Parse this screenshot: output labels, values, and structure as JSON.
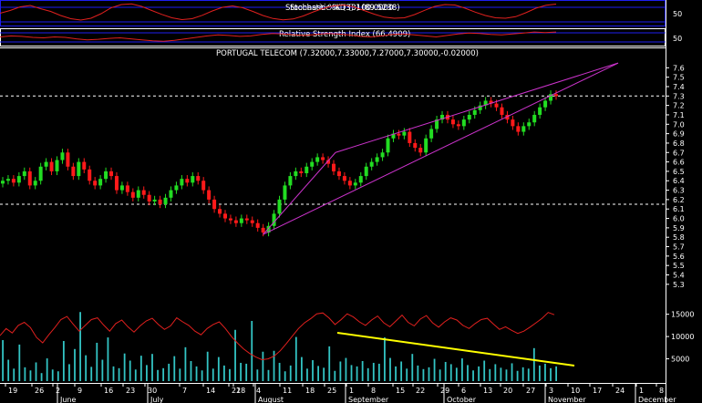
{
  "chart_data": [
    {
      "panel": "stochastic",
      "type": "line",
      "title": "Stochastic %D (3) (89.5238)",
      "overlapping_label": "Stochastic %K (3) 100.0000",
      "y_ticks": [
        "50"
      ],
      "values": [
        50,
        62,
        78,
        84,
        70,
        58,
        40,
        26,
        20,
        28,
        48,
        74,
        88,
        91,
        80,
        62,
        45,
        30,
        22,
        26,
        41,
        60,
        76,
        82,
        74,
        58,
        40,
        27,
        21,
        25,
        38,
        56,
        72,
        82,
        86,
        78,
        62,
        46,
        33,
        28,
        30,
        44,
        63,
        80,
        88,
        86,
        72,
        55,
        40,
        30,
        28,
        35,
        52,
        72,
        85,
        90
      ]
    },
    {
      "panel": "rsi",
      "type": "line",
      "title": "Relative Strength Index (66.4909)",
      "y_ticks": [
        "50"
      ],
      "values": [
        56,
        58,
        57,
        55,
        54,
        56,
        55,
        52,
        50,
        51,
        53,
        54,
        52,
        50,
        48,
        47,
        49,
        52,
        55,
        58,
        60,
        59,
        57,
        58,
        61,
        63,
        62,
        60,
        59,
        61,
        63,
        62,
        60,
        57,
        56,
        58,
        61,
        62,
        60,
        58,
        56,
        59,
        62,
        64,
        63,
        61,
        60,
        62,
        64,
        66,
        65,
        66
      ]
    },
    {
      "panel": "price",
      "type": "candlestick",
      "title": "PORTUGAL TELECOM (7.32000,7.33000,7.27000,7.30000,-0.02000)",
      "y_ticks": [
        "7.6",
        "7.5",
        "7.4",
        "7.3",
        "7.2",
        "7.1",
        "7.0",
        "6.9",
        "6.8",
        "6.7",
        "6.6",
        "6.5",
        "6.4",
        "6.3",
        "6.2",
        "6.1",
        "6.0",
        "5.9",
        "5.8",
        "5.7",
        "5.6",
        "5.5",
        "5.4",
        "5.3"
      ],
      "ylim": [
        5.25,
        7.7
      ],
      "h_lines": [
        7.3,
        6.15
      ],
      "closes": [
        6.4,
        6.42,
        6.38,
        6.45,
        6.5,
        6.35,
        6.4,
        6.55,
        6.6,
        6.5,
        6.62,
        6.7,
        6.55,
        6.45,
        6.6,
        6.52,
        6.4,
        6.35,
        6.42,
        6.5,
        6.45,
        6.3,
        6.35,
        6.28,
        6.22,
        6.3,
        6.25,
        6.18,
        6.2,
        6.15,
        6.22,
        6.3,
        6.35,
        6.42,
        6.38,
        6.45,
        6.4,
        6.3,
        6.2,
        6.1,
        6.05,
        6.0,
        5.98,
        5.95,
        6.0,
        5.98,
        5.95,
        5.9,
        5.85,
        5.92,
        6.05,
        6.2,
        6.35,
        6.45,
        6.5,
        6.48,
        6.55,
        6.6,
        6.65,
        6.62,
        6.58,
        6.5,
        6.45,
        6.4,
        6.35,
        6.38,
        6.45,
        6.55,
        6.6,
        6.65,
        6.7,
        6.85,
        6.9,
        6.88,
        6.92,
        6.8,
        6.75,
        6.7,
        6.85,
        6.95,
        7.05,
        7.1,
        7.05,
        7.0,
        6.98,
        7.05,
        7.1,
        7.15,
        7.2,
        7.25,
        7.22,
        7.18,
        7.1,
        7.05,
        6.98,
        6.92,
        6.98,
        7.02,
        7.1,
        7.18,
        7.25,
        7.32,
        7.3
      ],
      "trendlines": [
        {
          "from": [
            "Aug 4",
            5.83
          ],
          "to": [
            "Nov 17",
            7.65
          ]
        },
        {
          "from": [
            "Sep 25",
            6.7
          ],
          "to": [
            "Nov 17",
            7.65
          ]
        },
        {
          "from": [
            "Aug 4",
            5.83
          ],
          "to": [
            "Sep 25",
            6.7
          ]
        }
      ]
    },
    {
      "panel": "volume",
      "type": "bar",
      "y_ticks": [
        "15000",
        "10000",
        "5000"
      ],
      "ylim": [
        0,
        18000
      ],
      "values": [
        9200,
        4800,
        2800,
        8200,
        3100,
        2400,
        4200,
        1800,
        5100,
        2600,
        2200,
        9000,
        3800,
        7200,
        15500,
        5800,
        3200,
        8600,
        4800,
        9800,
        3300,
        2900,
        6200,
        4600,
        2600,
        5700,
        3600,
        6100,
        2500,
        2900,
        3900,
        5600,
        2800,
        7600,
        4500,
        3300,
        2400,
        6600,
        2800,
        5400,
        3500,
        2700,
        11500,
        4100,
        3900,
        13500,
        2600,
        6600,
        2500,
        6800,
        4100,
        2200,
        3500,
        9900,
        5400,
        2800,
        4700,
        3400,
        3000,
        7800,
        2300,
        4400,
        5200,
        3600,
        3300,
        4500,
        2900,
        4100,
        3900,
        9800,
        5200,
        3300,
        4400,
        2800,
        6100,
        3500,
        2700,
        3100,
        5000,
        2600,
        4300,
        3800,
        3000,
        5100,
        3600,
        2400,
        3300,
        4600,
        2700,
        3800,
        3000,
        2600,
        4000,
        2300,
        3100,
        2800,
        7400,
        3500,
        3900,
        2900,
        3300
      ],
      "overlay_line": [
        10200,
        11800,
        10800,
        12500,
        13200,
        12000,
        9800,
        8600,
        10400,
        12000,
        13800,
        14500,
        12800,
        11200,
        12500,
        13800,
        14200,
        12600,
        11200,
        12900,
        13700,
        12200,
        11000,
        12400,
        13500,
        14100,
        12700,
        11600,
        12400,
        14200,
        13300,
        12500,
        11200,
        10400,
        11800,
        12700,
        13300,
        11800,
        10000,
        8500,
        7200,
        6200,
        5400,
        4800,
        5000,
        5600,
        6800,
        8400,
        10100,
        11800,
        13100,
        14000,
        15100,
        15300,
        14200,
        12700,
        13800,
        15100,
        14400,
        13300,
        12500,
        13700,
        14600,
        13100,
        12200,
        13500,
        14800,
        13200,
        12400,
        13900,
        14700,
        13100,
        12100,
        13300,
        14200,
        13700,
        12500,
        11800,
        12900,
        13800,
        14100,
        12800,
        11600,
        12200,
        11400,
        10700,
        11200,
        12100,
        13100,
        14100,
        15400,
        14900
      ]
    }
  ],
  "x_axis": {
    "day_labels": [
      "19",
      "26",
      "2",
      "9",
      "16",
      "23",
      "30",
      "7",
      "14",
      "21",
      "28",
      "4",
      "11",
      "18",
      "25",
      "1",
      "8",
      "15",
      "22",
      "29",
      "6",
      "13",
      "20",
      "27",
      "3",
      "10",
      "17",
      "24",
      "1",
      "8"
    ],
    "month_labels": [
      "June",
      "July",
      "August",
      "September",
      "October",
      "November",
      "December"
    ]
  },
  "colors": {
    "up": "#22dd22",
    "down": "#ff1a1a",
    "trend": "#cc33cc",
    "volume": "#33c4c4",
    "volume_trend": "#ffff00",
    "panel_border": "#1e1ef0"
  }
}
